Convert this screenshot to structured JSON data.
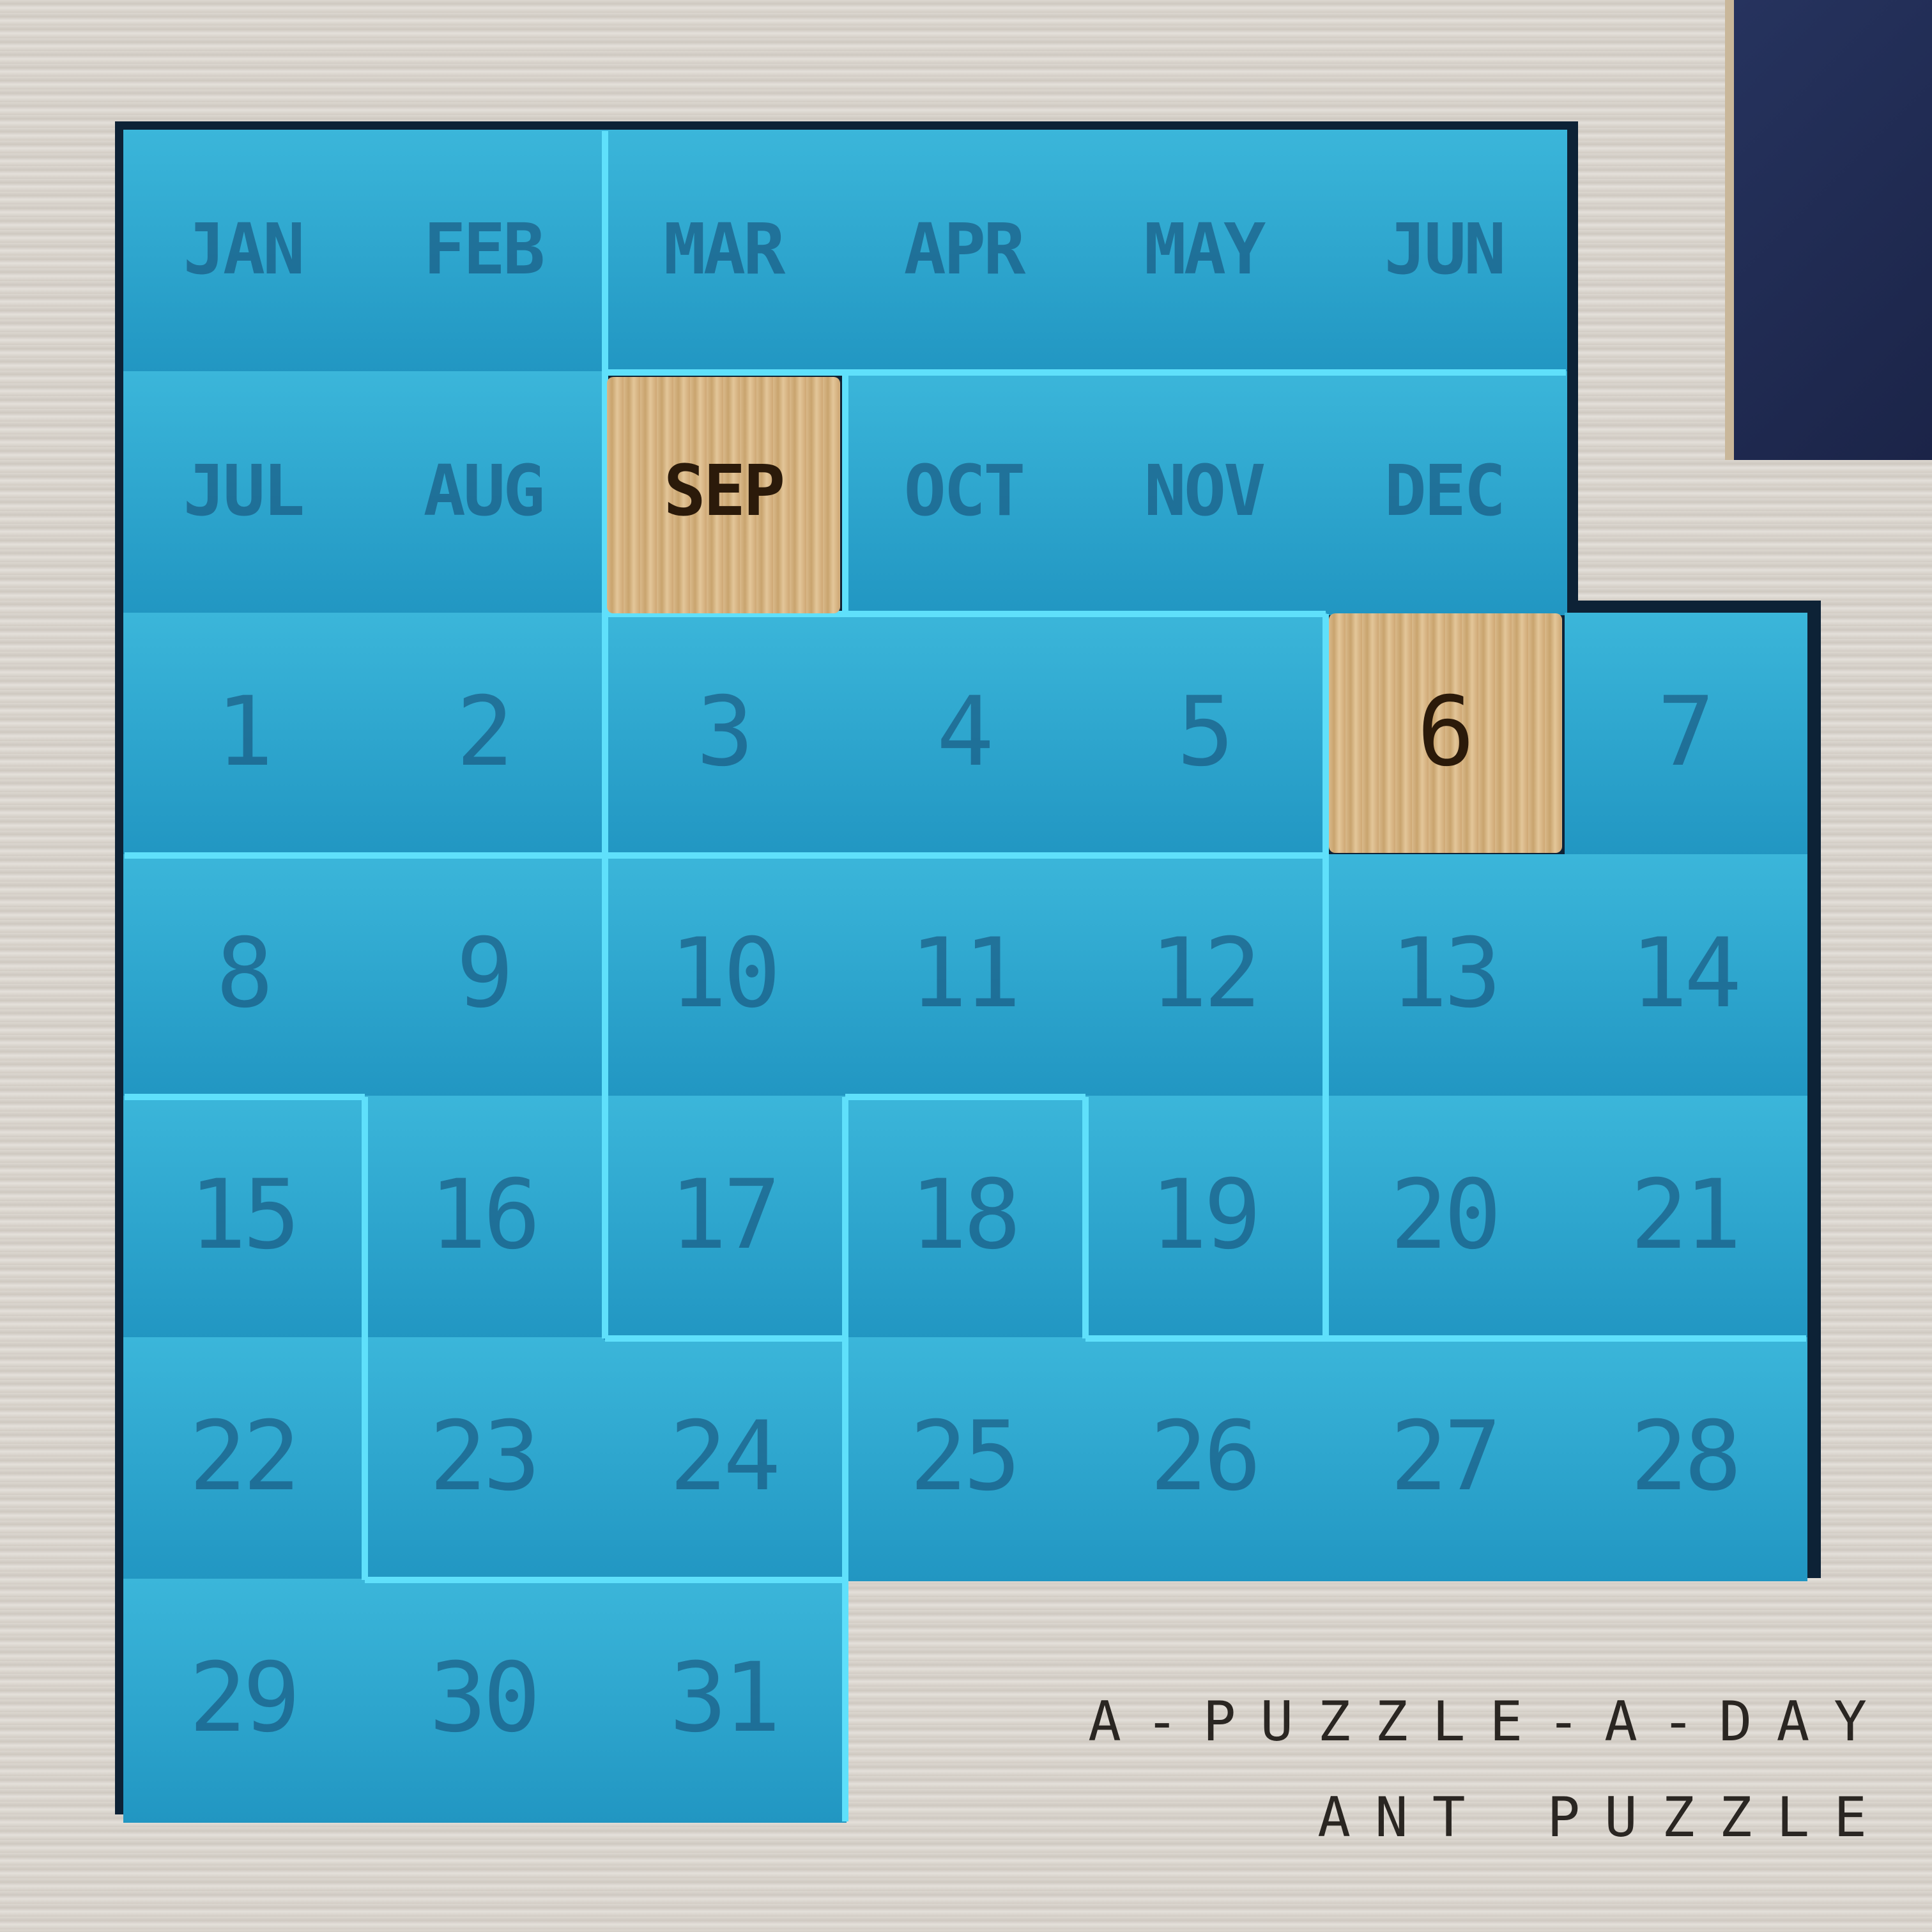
{
  "calendar": {
    "months_row1": [
      "JAN",
      "FEB",
      "MAR",
      "APR",
      "MAY",
      "JUN"
    ],
    "months_row2": [
      "JUL",
      "AUG",
      "SEP",
      "OCT",
      "NOV",
      "DEC"
    ],
    "days": [
      "1",
      "2",
      "3",
      "4",
      "5",
      "6",
      "7",
      "8",
      "9",
      "10",
      "11",
      "12",
      "13",
      "14",
      "15",
      "16",
      "17",
      "18",
      "19",
      "20",
      "21",
      "22",
      "23",
      "24",
      "25",
      "26",
      "27",
      "28",
      "29",
      "30",
      "31"
    ],
    "uncovered_month": "SEP",
    "uncovered_day": "6"
  },
  "brand": {
    "line1": "A-PUZZLE-A-DAY",
    "line2": "ANT PUZZLE"
  },
  "colors": {
    "piece": "#2ea8cf",
    "piece_edge": "#3fd3f2",
    "wood": "#d4b283",
    "engraving": "#2b1a0a",
    "board": "#d8d3cc"
  }
}
